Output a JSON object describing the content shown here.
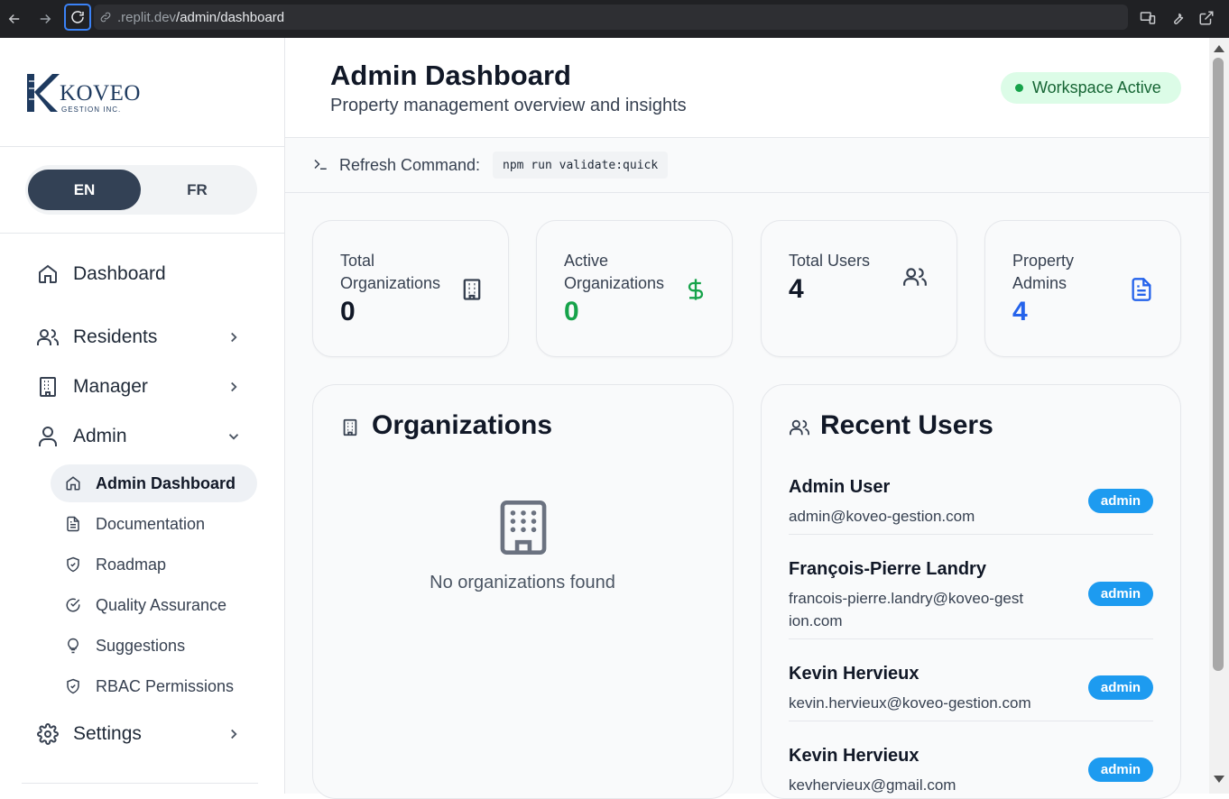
{
  "browser": {
    "url_domain": ".replit.dev",
    "url_path": "/admin/dashboard"
  },
  "sidebar": {
    "logo_text": "KOVEO",
    "logo_subtext": "GESTION INC.",
    "lang": {
      "en": "EN",
      "fr": "FR",
      "active": "EN"
    },
    "items": [
      {
        "label": "Dashboard",
        "icon": "home-icon"
      },
      {
        "label": "Residents",
        "icon": "users-icon"
      },
      {
        "label": "Manager",
        "icon": "building-icon"
      },
      {
        "label": "Admin",
        "icon": "user-icon"
      },
      {
        "label": "Settings",
        "icon": "gear-icon"
      }
    ],
    "admin_sub": [
      {
        "label": "Admin Dashboard",
        "icon": "home-icon",
        "active": true
      },
      {
        "label": "Documentation",
        "icon": "document-icon"
      },
      {
        "label": "Roadmap",
        "icon": "shield-icon"
      },
      {
        "label": "Quality Assurance",
        "icon": "check-circle-icon"
      },
      {
        "label": "Suggestions",
        "icon": "lightbulb-icon"
      },
      {
        "label": "RBAC Permissions",
        "icon": "shield-icon"
      }
    ]
  },
  "header": {
    "title": "Admin Dashboard",
    "subtitle": "Property management overview and insights",
    "status": "Workspace Active"
  },
  "command": {
    "label": "Refresh Command:",
    "code": "npm run validate:quick"
  },
  "stats": [
    {
      "label": "Total Organizations",
      "value": "0",
      "color": "#111827",
      "icon": "building-icon"
    },
    {
      "label": "Active Organizations",
      "value": "0",
      "color": "#16a34a",
      "icon": "dollar-icon"
    },
    {
      "label": "Total Users",
      "value": "4",
      "color": "#111827",
      "icon": "users-icon"
    },
    {
      "label": "Property Admins",
      "value": "4",
      "color": "#2563eb",
      "icon": "document-icon"
    }
  ],
  "organizations": {
    "title": "Organizations",
    "empty_text": "No organizations found"
  },
  "recent_users": {
    "title": "Recent Users",
    "users": [
      {
        "name": "Admin User",
        "email": "admin@koveo-gestion.com",
        "role": "admin"
      },
      {
        "name": "François-Pierre Landry",
        "email": "francois-pierre.landry@koveo-gestion.com",
        "role": "admin"
      },
      {
        "name": "Kevin Hervieux",
        "email": "kevin.hervieux@koveo-gestion.com",
        "role": "admin"
      },
      {
        "name": "Kevin Hervieux",
        "email": "kevhervieux@gmail.com",
        "role": "admin"
      }
    ]
  }
}
